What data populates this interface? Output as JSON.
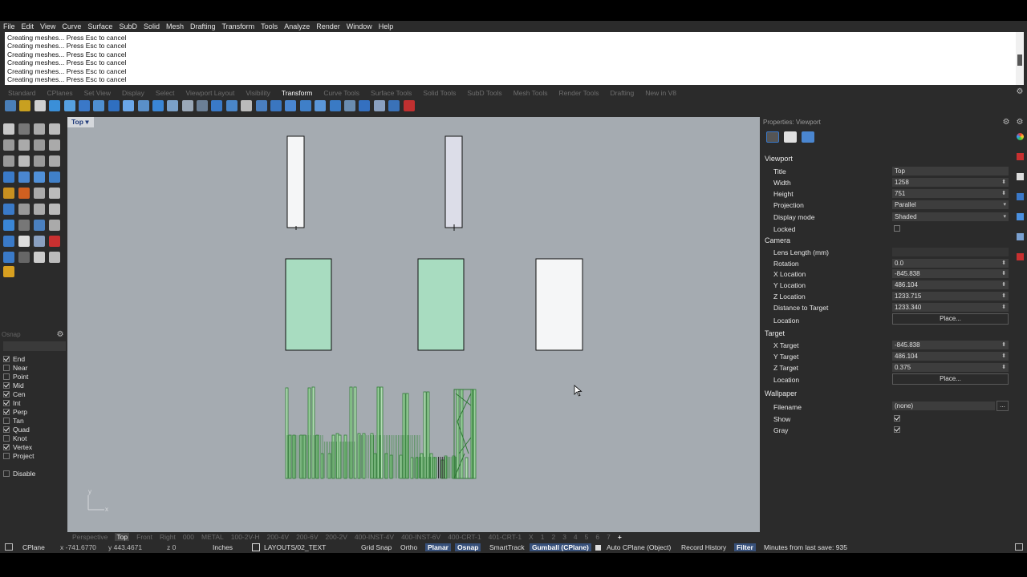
{
  "menu": [
    "File",
    "Edit",
    "View",
    "Curve",
    "Surface",
    "SubD",
    "Solid",
    "Mesh",
    "Drafting",
    "Transform",
    "Tools",
    "Analyze",
    "Render",
    "Window",
    "Help"
  ],
  "command_history": [
    "Creating meshes... Press Esc to cancel",
    "Creating meshes... Press Esc to cancel",
    "Creating meshes... Press Esc to cancel",
    "Creating meshes... Press Esc to cancel",
    "Creating meshes... Press Esc to cancel",
    "Creating meshes... Press Esc to cancel"
  ],
  "toolbar_tabs": [
    "Standard",
    "CPlanes",
    "Set View",
    "Display",
    "Select",
    "Viewport Layout",
    "Visibility",
    "Transform",
    "Curve Tools",
    "Surface Tools",
    "Solid Tools",
    "SubD Tools",
    "Mesh Tools",
    "Render Tools",
    "Drafting",
    "New in V8"
  ],
  "active_tab": "Transform",
  "viewport": {
    "title": "Top",
    "title_dropdown": "▾",
    "axis_x": "x",
    "axis_y": "y"
  },
  "viewport_tabs": [
    "Perspective",
    "Top",
    "Front",
    "Right",
    "000",
    "METAL",
    "100-2V-H",
    "200-4V",
    "200-6V",
    "200-2V",
    "400-INST-4V",
    "400-INST-6V",
    "400-CRT-1",
    "401-CRT-1",
    "X",
    "1",
    "2",
    "3",
    "4",
    "5",
    "6",
    "7",
    "+"
  ],
  "active_viewport_tab": "Top",
  "osnap": {
    "title": "Osnap",
    "items": [
      {
        "label": "End",
        "checked": true
      },
      {
        "label": "Near",
        "checked": false
      },
      {
        "label": "Point",
        "checked": false
      },
      {
        "label": "Mid",
        "checked": true
      },
      {
        "label": "Cen",
        "checked": true
      },
      {
        "label": "Int",
        "checked": true
      },
      {
        "label": "Perp",
        "checked": true
      },
      {
        "label": "Tan",
        "checked": false
      },
      {
        "label": "Quad",
        "checked": true
      },
      {
        "label": "Knot",
        "checked": false
      },
      {
        "label": "Vertex",
        "checked": true
      },
      {
        "label": "Project",
        "checked": false
      }
    ],
    "disable": "Disable"
  },
  "properties": {
    "title": "Properties: Viewport",
    "viewport_section": "Viewport",
    "title_label": "Title",
    "title_value": "Top",
    "width_label": "Width",
    "width_value": "1258",
    "height_label": "Height",
    "height_value": "751",
    "projection_label": "Projection",
    "projection_value": "Parallel",
    "display_label": "Display mode",
    "display_value": "Shaded",
    "locked_label": "Locked",
    "camera_section": "Camera",
    "lens_label": "Lens Length (mm)",
    "rotation_label": "Rotation",
    "rotation_value": "0.0",
    "xloc_label": "X Location",
    "xloc_value": "-845.838",
    "yloc_label": "Y Location",
    "yloc_value": "486.104",
    "zloc_label": "Z Location",
    "zloc_value": "1233.715",
    "dist_label": "Distance to Target",
    "dist_value": "1233.340",
    "loc_label": "Location",
    "place_label": "Place...",
    "target_section": "Target",
    "xt_label": "X Target",
    "xt_value": "-845.838",
    "yt_label": "Y Target",
    "yt_value": "486.104",
    "zt_label": "Z Target",
    "zt_value": "0.375",
    "tloc_label": "Location",
    "tplace_label": "Place...",
    "wall_section": "Wallpaper",
    "file_label": "Filename",
    "file_value": "(none)",
    "file_btn": "...",
    "show_label": "Show",
    "gray_label": "Gray"
  },
  "status": {
    "cplane": "CPlane",
    "x": "x -741.6770",
    "y": "y 443.4671",
    "z": "z 0",
    "units": "Inches",
    "layer": "LAYOUTS/02_TEXT",
    "grid_snap": "Grid Snap",
    "ortho": "Ortho",
    "planar": "Planar",
    "osnap": "Osnap",
    "smarttrack": "SmartTrack",
    "gumball": "Gumball (CPlane)",
    "autocplane": "Auto CPlane (Object)",
    "record": "Record History",
    "filter": "Filter",
    "save": "Minutes from last save: 935"
  }
}
